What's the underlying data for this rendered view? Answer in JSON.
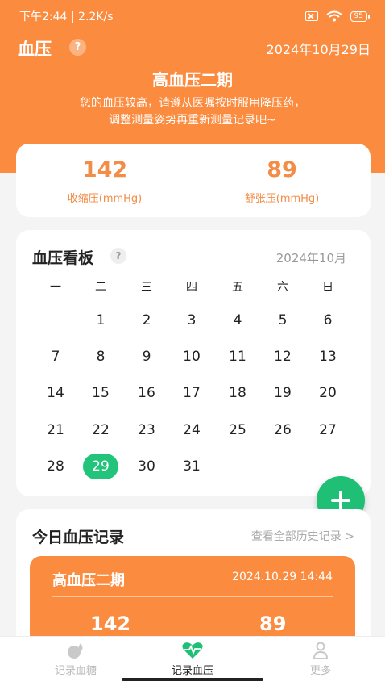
{
  "status_bar": {
    "time_speed": "下午2:44 | 2.2K/s",
    "battery": "95"
  },
  "header": {
    "title": "血压",
    "help": "?",
    "date": "2024年10月29日",
    "status_title": "高血压二期",
    "desc_line1": "您的血压较高，请遵从医嘱按时服用降压药，",
    "desc_line2": "调整测量姿势再重新测量记录吧~"
  },
  "summary": {
    "systolic_value": "142",
    "systolic_label": "收缩压(mmHg)",
    "diastolic_value": "89",
    "diastolic_label": "舒张压(mmHg)"
  },
  "calendar": {
    "title": "血压看板",
    "help": "?",
    "month": "2024年10月",
    "weekdays": [
      "一",
      "二",
      "三",
      "四",
      "五",
      "六",
      "日"
    ],
    "weeks": [
      [
        "",
        "1",
        "2",
        "3",
        "4",
        "5",
        "6"
      ],
      [
        "7",
        "8",
        "9",
        "10",
        "11",
        "12",
        "13"
      ],
      [
        "14",
        "15",
        "16",
        "17",
        "18",
        "19",
        "20"
      ],
      [
        "21",
        "22",
        "23",
        "24",
        "25",
        "26",
        "27"
      ],
      [
        "28",
        "29",
        "30",
        "31",
        "",
        "",
        ""
      ]
    ],
    "today": "29"
  },
  "records": {
    "title": "今日血压记录",
    "history_link": "查看全部历史记录 >",
    "item": {
      "status": "高血压二期",
      "datetime": "2024.10.29  14:44",
      "systolic": "142",
      "diastolic": "89"
    }
  },
  "tabs": [
    {
      "label": "记录血糖",
      "icon": "blood-drop-icon"
    },
    {
      "label": "记录血压",
      "icon": "heart-pulse-icon"
    },
    {
      "label": "更多",
      "icon": "person-icon"
    }
  ],
  "colors": {
    "primary": "#fb8b3f",
    "accent_green": "#1fbf75",
    "value_orange": "#f28c46"
  }
}
